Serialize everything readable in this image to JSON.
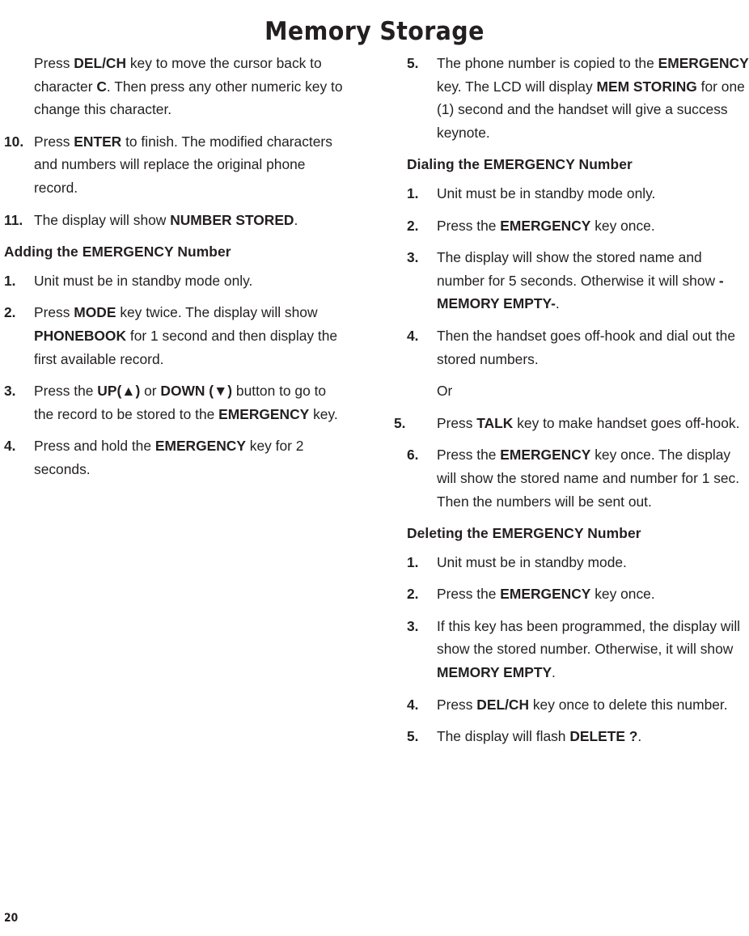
{
  "document": {
    "title": "Memory Storage",
    "page_number": "20",
    "text_color": "#231f20",
    "background_color": "#ffffff"
  },
  "left_column": {
    "intro_paragraph": {
      "html": "Press <b>DEL/CH</b> key to move the cursor back to character <b>C</b>. Then press any other numeric key to change this character."
    },
    "items": [
      {
        "num": "10.",
        "html": "Press <b>ENTER</b> to finish. The modified characters and numbers will replace the original phone record."
      },
      {
        "num": "11.",
        "html": "The display will show <b>NUMBER STORED</b>."
      }
    ],
    "section": {
      "heading_html": "Adding the <b>EMERGENCY</b> Number",
      "heading_text": "Adding the EMERGENCY Number",
      "items": [
        {
          "num": "1.",
          "html": "Unit must be in standby mode only."
        },
        {
          "num": "2.",
          "html": "Press <b>MODE</b> key twice. The display will show <b>PHONEBOOK</b> for 1 second and then display the first available record."
        },
        {
          "num": "3.",
          "html": "Press the <b>UP(&#9650;)</b> or <b>DOWN (&#9660;)</b> button to go to the record to be stored to the <b>EMERGENCY</b> key."
        },
        {
          "num": "4.",
          "html": "Press and hold the <b>EMERGENCY</b> key for 2 seconds."
        }
      ]
    }
  },
  "right_column": {
    "continued_items": [
      {
        "num": "5.",
        "html": "The phone number is copied to the <b>EMERGENCY</b> key. The LCD will display <b>MEM STORING</b> for one (1) second and the handset will give a success keynote."
      }
    ],
    "section_dialing": {
      "heading_html": "Dialing the <b>EMERGENCY</b> Number",
      "heading_text": "Dialing the EMERGENCY Number",
      "items": [
        {
          "num": "1.",
          "html": "Unit must be in standby mode only."
        },
        {
          "num": "2.",
          "html": "Press the <b>EMERGENCY</b> key once."
        },
        {
          "num": "3.",
          "html": "The display will show the stored name and number for 5 seconds. Otherwise it will show <b>-MEMORY EMPTY-</b>."
        },
        {
          "num": "4.",
          "html": "Then the handset goes off-hook and dial out the stored numbers."
        }
      ],
      "or_text": "Or",
      "items_after_or": [
        {
          "num": "5.",
          "html": "Press <b>TALK</b> key to make handset goes off-hook."
        },
        {
          "num": "6.",
          "html": "Press the <b>EMERGENCY</b> key once. The display will show the stored name and number for 1 sec. Then the numbers will be sent out."
        }
      ]
    },
    "section_deleting": {
      "heading_html": "Deleting the <b>EMERGENCY</b> Number",
      "heading_text": "Deleting the EMERGENCY Number",
      "items": [
        {
          "num": "1.",
          "html": "Unit must be in standby mode."
        },
        {
          "num": "2.",
          "html": "Press the <b>EMERGENCY</b> key once."
        },
        {
          "num": "3.",
          "html": "If this key has been programmed, the display will show the stored number. Otherwise, it will show <b>MEMORY EMPTY</b>."
        },
        {
          "num": "4.",
          "html": "Press <b>DEL/CH</b> key once to delete this number."
        },
        {
          "num": "5.",
          "html": "The display will flash <b>DELETE ?</b>."
        }
      ]
    }
  }
}
